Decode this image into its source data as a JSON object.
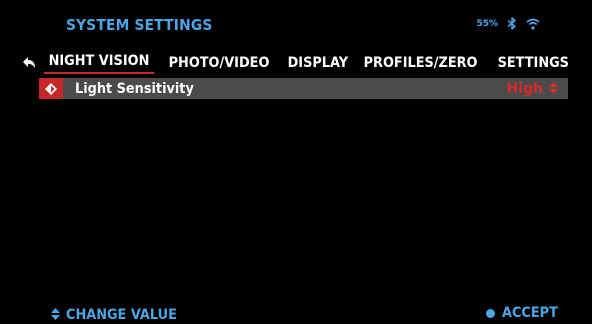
{
  "header": {
    "title": "SYSTEM SETTINGS",
    "battery": "55%"
  },
  "tabs": [
    {
      "label": "NIGHT VISION",
      "active": true
    },
    {
      "label": "PHOTO/VIDEO",
      "active": false
    },
    {
      "label": "DISPLAY",
      "active": false
    },
    {
      "label": "PROFILES/ZERO",
      "active": false
    },
    {
      "label": "SETTINGS",
      "active": false
    }
  ],
  "setting": {
    "label": "Light Sensitivity",
    "value": "High"
  },
  "footer": {
    "change_label": "CHANGE VALUE",
    "accept_label": "ACCEPT"
  },
  "colors": {
    "accent": "#4aa6e6",
    "highlight": "#c62828",
    "row_bg": "#4b4b4b"
  }
}
